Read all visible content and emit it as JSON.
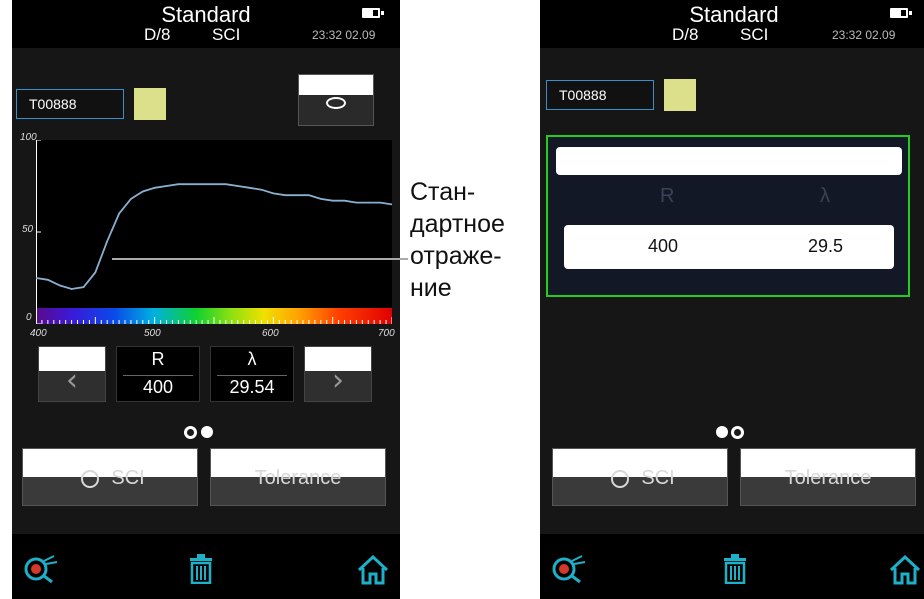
{
  "left_screen": {
    "title": "Standard",
    "geometry": "D/8",
    "mode": "SCI",
    "time": "23:32 02.09",
    "sample_id": "T00888",
    "swatch_color": "#dce08a",
    "chart_data": {
      "type": "line",
      "x": [
        400,
        410,
        420,
        430,
        440,
        450,
        460,
        470,
        480,
        490,
        500,
        510,
        520,
        530,
        540,
        550,
        560,
        570,
        580,
        590,
        600,
        610,
        620,
        630,
        640,
        650,
        660,
        670,
        680,
        690,
        700
      ],
      "values": [
        25,
        24,
        21,
        19,
        20,
        28,
        45,
        60,
        68,
        72,
        74,
        75,
        76,
        76,
        76,
        76,
        76,
        75,
        74,
        73,
        71,
        70,
        70,
        70,
        68,
        67,
        67,
        66,
        66,
        66,
        65
      ],
      "ylim": [
        0,
        100
      ],
      "xlim": [
        400,
        700
      ],
      "yticks": [
        "100",
        "50",
        "0"
      ],
      "xticks": [
        "400",
        "500",
        "600",
        "700"
      ],
      "line_color": "#8ab0d0"
    },
    "readout": {
      "col1_label": "R",
      "col2_label": "λ",
      "col1_value": "400",
      "col2_value": "29.54"
    },
    "buttons": {
      "prev": "‹",
      "next": "›",
      "mode_btn": "SCI",
      "tolerance_btn": "Tolerance"
    }
  },
  "right_screen": {
    "title": "Standard",
    "geometry": "D/8",
    "mode": "SCI",
    "time": "23:32 02.09",
    "sample_id": "T00888",
    "swatch_color": "#dce08a",
    "table": {
      "col1_header": "R",
      "col2_header": "λ",
      "col1_value": "400",
      "col2_value": "29.5"
    },
    "buttons": {
      "mode_btn": "SCI",
      "tolerance_btn": "Tolerance"
    }
  },
  "annotation": {
    "lines": [
      "Стан-",
      "дартное",
      "отраже-",
      "ние"
    ]
  }
}
